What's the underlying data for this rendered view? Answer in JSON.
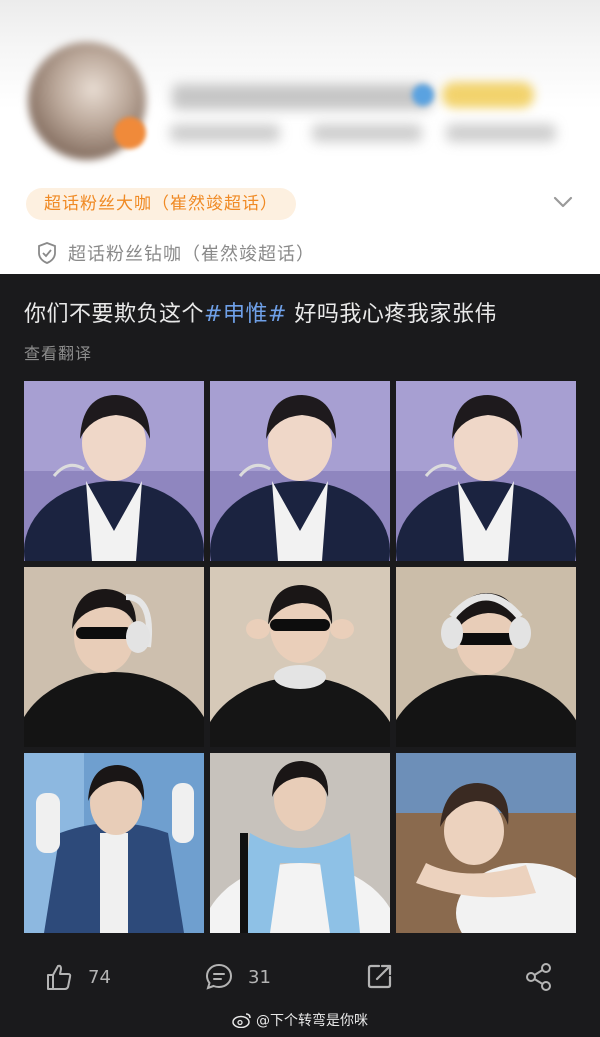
{
  "profile": {
    "fan_badge": "超话粉丝大咖（崔然竣超话）",
    "diamond_label": "超话粉丝钻咖（崔然竣超话）"
  },
  "post": {
    "text_before": "你们不要欺负这个",
    "hashtag": "#申惟#",
    "text_after": " 好吗我心疼我家张伟",
    "translate": "查看翻译",
    "photos": [
      {
        "scene": "purple-studio-portrait"
      },
      {
        "scene": "purple-studio-portrait"
      },
      {
        "scene": "purple-studio-portrait"
      },
      {
        "scene": "sunglasses-headphones"
      },
      {
        "scene": "adjusting-sunglasses"
      },
      {
        "scene": "headphones-on"
      },
      {
        "scene": "varsity-jacket"
      },
      {
        "scene": "blue-scarf"
      },
      {
        "scene": "lying-on-arm"
      }
    ]
  },
  "actions": {
    "like_count": "74",
    "comment_count": "31"
  },
  "watermark": "@下个转弯是你咪",
  "icons": [
    "shield-icon",
    "chevron-down-icon",
    "thumbs-up-icon",
    "comment-icon",
    "repost-icon",
    "share-icon",
    "weibo-icon"
  ],
  "colors": {
    "accent_orange": "#f08a24",
    "hashtag_blue": "#6fa0e8",
    "dark_bg": "#1a1a1c"
  }
}
